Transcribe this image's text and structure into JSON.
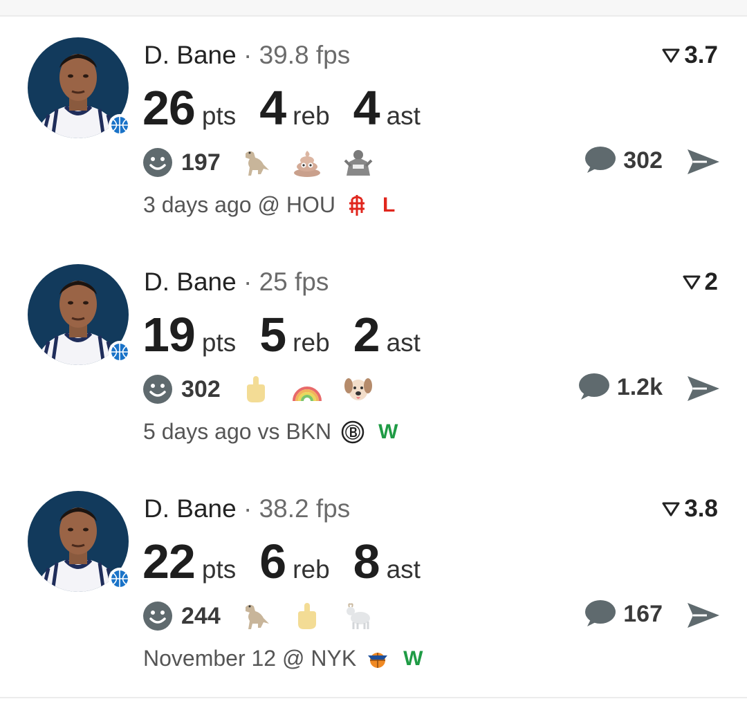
{
  "posts": [
    {
      "player": "D. Bane",
      "separator": "·",
      "fps": "39.8 fps",
      "rating": "3.7",
      "stats": [
        {
          "value": "26",
          "unit": "pts"
        },
        {
          "value": "4",
          "unit": "reb"
        },
        {
          "value": "4",
          "unit": "ast"
        }
      ],
      "reaction_count": "197",
      "reaction_emojis": [
        "dinosaur-icon",
        "poop-icon",
        "player-sticker-icon"
      ],
      "comment_count": "302",
      "when": "3 days ago @ HOU",
      "team_logo": "rockets-logo-icon",
      "result": "L"
    },
    {
      "player": "D. Bane",
      "separator": "·",
      "fps": "25 fps",
      "rating": "2",
      "stats": [
        {
          "value": "19",
          "unit": "pts"
        },
        {
          "value": "5",
          "unit": "reb"
        },
        {
          "value": "2",
          "unit": "ast"
        }
      ],
      "reaction_count": "302",
      "reaction_emojis": [
        "middle-finger-icon",
        "rainbow-icon",
        "dog-face-icon"
      ],
      "comment_count": "1.2k",
      "when": "5 days ago vs BKN",
      "team_logo": "nets-logo-icon",
      "result": "W"
    },
    {
      "player": "D. Bane",
      "separator": "·",
      "fps": "38.2 fps",
      "rating": "3.8",
      "stats": [
        {
          "value": "22",
          "unit": "pts"
        },
        {
          "value": "6",
          "unit": "reb"
        },
        {
          "value": "8",
          "unit": "ast"
        }
      ],
      "reaction_count": "244",
      "reaction_emojis": [
        "dinosaur-icon",
        "middle-finger-icon",
        "goat-icon"
      ],
      "comment_count": "167",
      "when": "November 12 @ NYK",
      "team_logo": "knicks-logo-icon",
      "result": "W"
    }
  ],
  "colors": {
    "loss": "#e0261d",
    "win": "#1f9b45",
    "icon_gray": "#5f6a6e",
    "divider": "#ececec"
  }
}
